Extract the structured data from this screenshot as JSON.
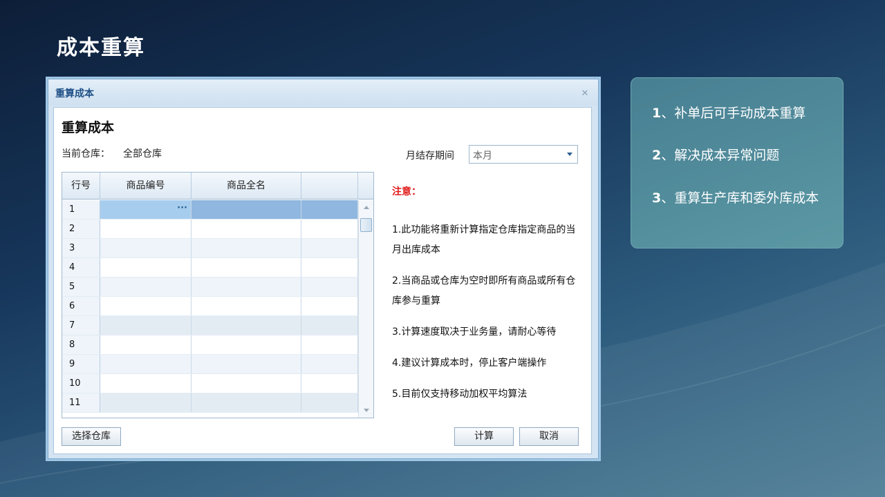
{
  "slide_title": "成本重算",
  "dialog": {
    "window_title": "重算成本",
    "close_glyph": "✕",
    "heading": "重算成本",
    "warehouse_label": "当前仓库：",
    "warehouse_value": "全部仓库",
    "period_label": "月结存期间",
    "period_value": "本月",
    "grid": {
      "columns": [
        "行号",
        "商品编号",
        "商品全名",
        ""
      ],
      "rows": [
        "1",
        "2",
        "3",
        "4",
        "5",
        "6",
        "7",
        "8",
        "9",
        "10",
        "11"
      ],
      "selected_row": "1",
      "ellipsis": "···"
    },
    "notes": {
      "title": "注意：",
      "items": [
        "1.此功能将重新计算指定仓库指定商品的当月出库成本",
        "2.当商品或仓库为空时即所有商品或所有仓库参与重算",
        "3.计算速度取决于业务量，请耐心等待",
        "4.建议计算成本时，停止客户端操作",
        "5.目前仅支持移动加权平均算法"
      ]
    },
    "buttons": {
      "select_warehouse": "选择仓库",
      "calculate": "计算",
      "cancel": "取消"
    }
  },
  "info_panel": {
    "items": [
      {
        "num": "1",
        "text": "、补单后可手动成本重算"
      },
      {
        "num": "2",
        "text": "、解决成本异常问题"
      },
      {
        "num": "3",
        "text": "、重算生产库和委外库成本"
      }
    ]
  },
  "colors": {
    "accent_blue": "#1e4f86",
    "warning_red": "#e01b1b",
    "panel_teal": "#5b98a4",
    "selected_row": "#8fb7df"
  }
}
